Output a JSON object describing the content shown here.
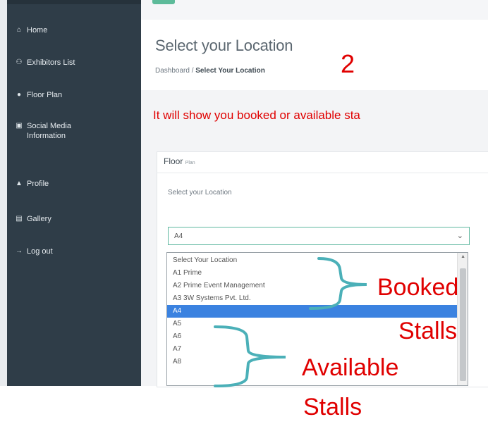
{
  "sidebar": {
    "items": [
      {
        "icon": "home-icon",
        "glyph": "⌂",
        "label": "Home"
      },
      {
        "icon": "users-icon",
        "glyph": "⚇",
        "label": "Exhibitors List"
      },
      {
        "icon": "map-pin-icon",
        "glyph": "●",
        "label": "Floor Plan"
      },
      {
        "icon": "social-icon",
        "glyph": "▣",
        "label": "Social Media Information"
      },
      {
        "icon": "user-icon",
        "glyph": "▲",
        "label": "Profile"
      },
      {
        "icon": "image-icon",
        "glyph": "▤",
        "label": "Gallery"
      },
      {
        "icon": "logout-icon",
        "glyph": "→",
        "label": "Log out"
      }
    ]
  },
  "header": {
    "page_title": "Select your Location",
    "breadcrumb_home": "Dashboard",
    "breadcrumb_sep": "/",
    "breadcrumb_current": "Select Your Location"
  },
  "annotations": {
    "step_number": "2",
    "note": "It will show you booked or available sta",
    "booked_line1": "Booked",
    "booked_line2": "Stalls",
    "available_line1": "Available",
    "available_line2": "Stalls",
    "color": "#e00000"
  },
  "card": {
    "title": "Floor",
    "title_small": "Plan",
    "field_label": "Select your Location",
    "select_value": "A4",
    "options": [
      "Select Your Location",
      "A1 Prime",
      "A2 Prime Event Management",
      "A3 3W Systems Pvt. Ltd.",
      "A4",
      "A5",
      "A6",
      "A7",
      "A8"
    ],
    "selected_option": "A4"
  },
  "colors": {
    "sidebar_bg": "#2f3d48",
    "accent": "#5dbb9a",
    "selected_bg": "#3b82e0",
    "bracket": "#4bb0b8"
  }
}
